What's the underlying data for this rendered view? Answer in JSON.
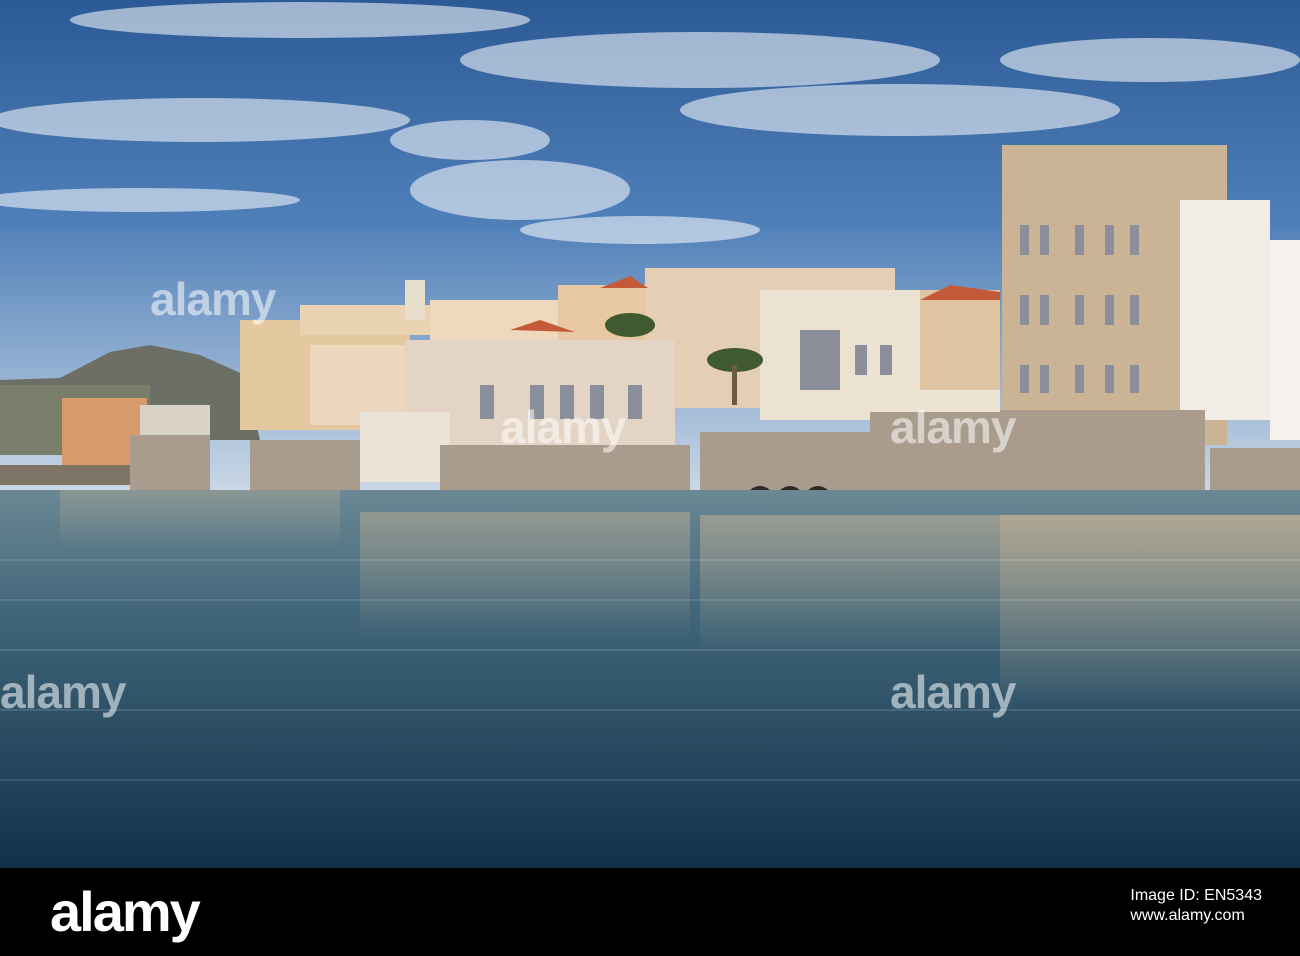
{
  "photo": {
    "subject": "waterfront neoclassical buildings on a harbour",
    "colors": {
      "sky_top": "#2f5f9a",
      "sky_low": "#c8d6e4",
      "sea_top": "#5d7f8e",
      "sea_bottom": "#14324a",
      "stone": "#cbb69a"
    }
  },
  "watermark": {
    "text": "alamy"
  },
  "footer": {
    "brand": "alamy",
    "image_id_label": "Image ID: EN5343",
    "site": "www.alamy.com"
  }
}
